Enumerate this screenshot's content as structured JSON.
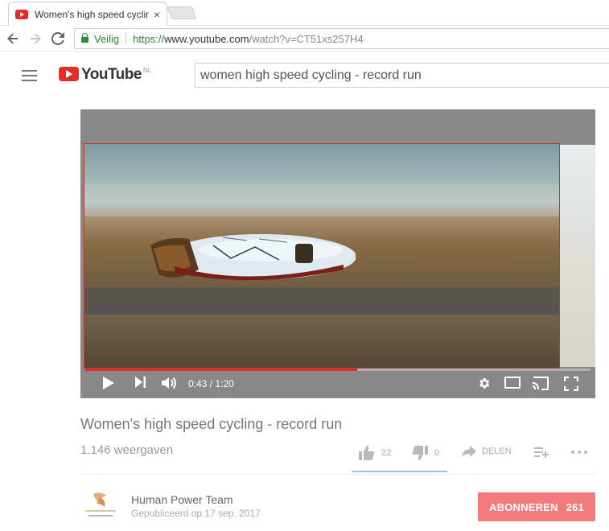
{
  "browser": {
    "tab_title": "Women's high speed cycling",
    "tab_close": "×",
    "secure_label": "Veilig",
    "url_proto": "https://",
    "url_host": "www.youtube.com",
    "url_path": "/watch?v=CT51xs257H4"
  },
  "header": {
    "logo_text": "YouTube",
    "logo_region": "NL",
    "search_value": "women high speed cycling - record run"
  },
  "player": {
    "time_display": "0:43 / 1:20",
    "progress_fraction": 0.5375
  },
  "video": {
    "title": "Women's high speed cycling - record run",
    "views": "1.146 weergaven",
    "likes": "22",
    "dislikes": "0",
    "share_label": "DELEN"
  },
  "channel": {
    "name": "Human Power Team",
    "published": "Gepubliceerd op 17 sep. 2017",
    "subscribe_label": "ABONNEREN",
    "subscriber_count": "261"
  },
  "colors": {
    "brand_red": "#e52d27",
    "secure_green": "#2d8a2d",
    "subscribe_bg": "#f47b7b"
  }
}
